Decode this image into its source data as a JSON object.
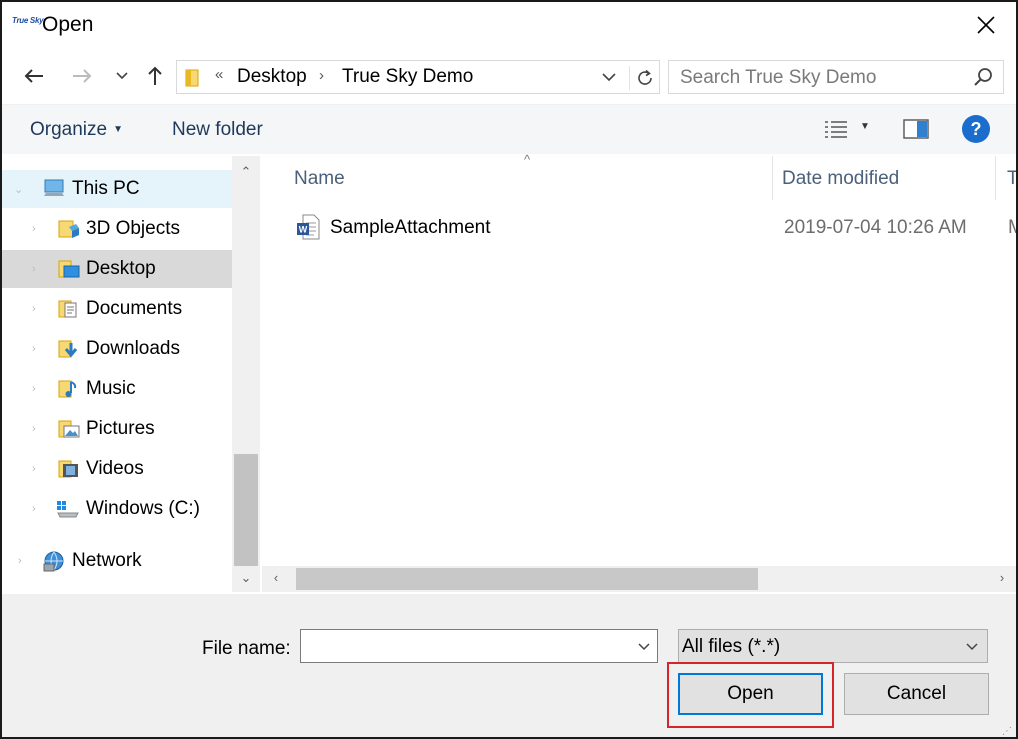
{
  "window": {
    "title": "Open",
    "app_logo_text": "True Sky",
    "close_icon": "close-icon"
  },
  "nav": {
    "back_icon": "back-arrow-icon",
    "forward_icon": "forward-arrow-icon",
    "recent_icon": "chevron-down-icon",
    "up_icon": "up-arrow-icon",
    "path_overflow": "«",
    "path": [
      "Desktop",
      "True Sky Demo"
    ],
    "search_placeholder": "Search True Sky Demo"
  },
  "toolbar": {
    "organize_label": "Organize",
    "new_folder_label": "New folder",
    "help_label": "?"
  },
  "tree": {
    "items": [
      {
        "label": "This PC",
        "icon": "computer-icon"
      },
      {
        "label": "3D Objects",
        "icon": "3d-objects-folder-icon"
      },
      {
        "label": "Desktop",
        "icon": "desktop-folder-icon"
      },
      {
        "label": "Documents",
        "icon": "documents-folder-icon"
      },
      {
        "label": "Downloads",
        "icon": "downloads-folder-icon"
      },
      {
        "label": "Music",
        "icon": "music-folder-icon"
      },
      {
        "label": "Pictures",
        "icon": "pictures-folder-icon"
      },
      {
        "label": "Videos",
        "icon": "videos-folder-icon"
      },
      {
        "label": "Windows (C:)",
        "icon": "drive-icon"
      },
      {
        "label": "Network",
        "icon": "network-icon"
      }
    ],
    "selected": "Desktop"
  },
  "list": {
    "columns": {
      "name": "Name",
      "date": "Date modified",
      "type": "T"
    },
    "files": [
      {
        "name": "SampleAttachment",
        "date": "2019-07-04 10:26 AM",
        "type": "M",
        "icon": "word-document-icon"
      }
    ]
  },
  "footer": {
    "file_name_label": "File name:",
    "file_name_value": "",
    "filter_value": "All files (*.*)",
    "open_label": "Open",
    "cancel_label": "Cancel"
  },
  "colors": {
    "accent": "#0078d7",
    "highlight": "#d8232a",
    "selection": "#d9d9d9",
    "help_blue": "#1a6dcc"
  }
}
